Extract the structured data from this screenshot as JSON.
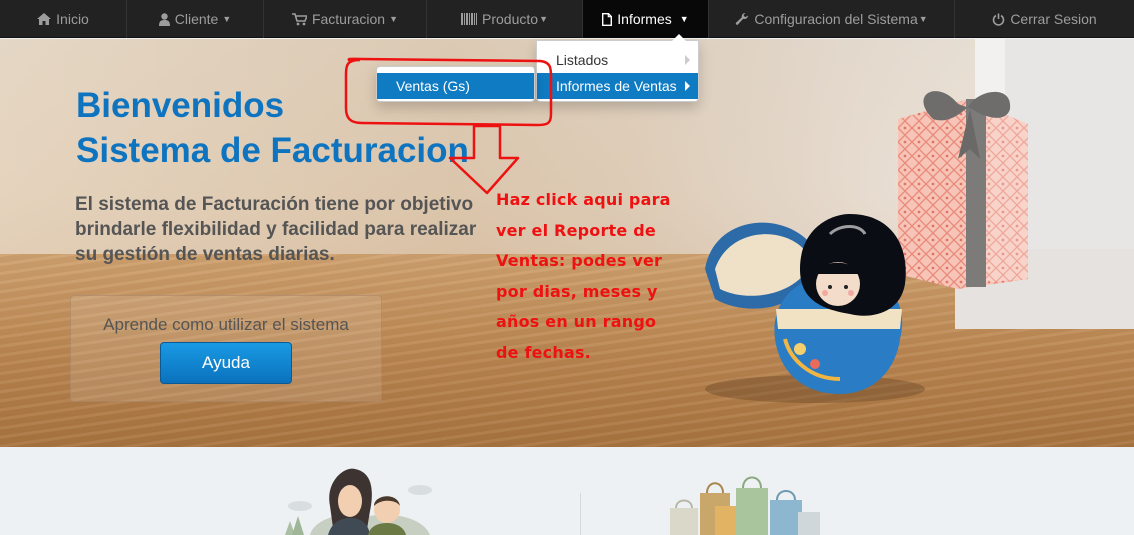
{
  "nav": {
    "items": [
      {
        "label": "Inicio",
        "icon": "home-icon",
        "caret": false,
        "active": false
      },
      {
        "label": "Cliente",
        "icon": "user-icon",
        "caret": true,
        "active": false
      },
      {
        "label": "Facturacion",
        "icon": "cart-icon",
        "caret": true,
        "active": false
      },
      {
        "label": "Producto",
        "icon": "barcode-icon",
        "caret": true,
        "active": false
      },
      {
        "label": "Informes",
        "icon": "file-icon",
        "caret": true,
        "active": true
      },
      {
        "label": "Configuracion del Sistema",
        "icon": "wrench-icon",
        "caret": true,
        "active": false
      },
      {
        "label": "Cerrar Sesion",
        "icon": "power-icon",
        "caret": false,
        "active": false
      }
    ]
  },
  "dropdown": {
    "items": [
      {
        "label": "Listados",
        "has_submenu": true,
        "active": false
      },
      {
        "label": "Informes de Ventas",
        "has_submenu": true,
        "active": true
      }
    ],
    "submenu": {
      "label": "Ventas (Gs)"
    }
  },
  "hero": {
    "title_line1": "Bienvenidos",
    "title_line2": "Sistema de Facturacion",
    "text": "El sistema de Facturación tiene por objetivo brindarle flexibilidad y facilidad para realizar su gestión de ventas diarias.",
    "help_label": "Aprende como utilizar el sistema",
    "help_button": "Ayuda"
  },
  "annotation": {
    "lines": [
      "Haz click aqui para",
      "ver el Reporte de",
      "Ventas: podes ver",
      "por dias, meses y",
      "años en un rango",
      "de fechas."
    ],
    "color": "#ee1111"
  },
  "colors": {
    "navbar": "#222222",
    "accent": "#0f7bc3",
    "title": "#0f74c0"
  }
}
